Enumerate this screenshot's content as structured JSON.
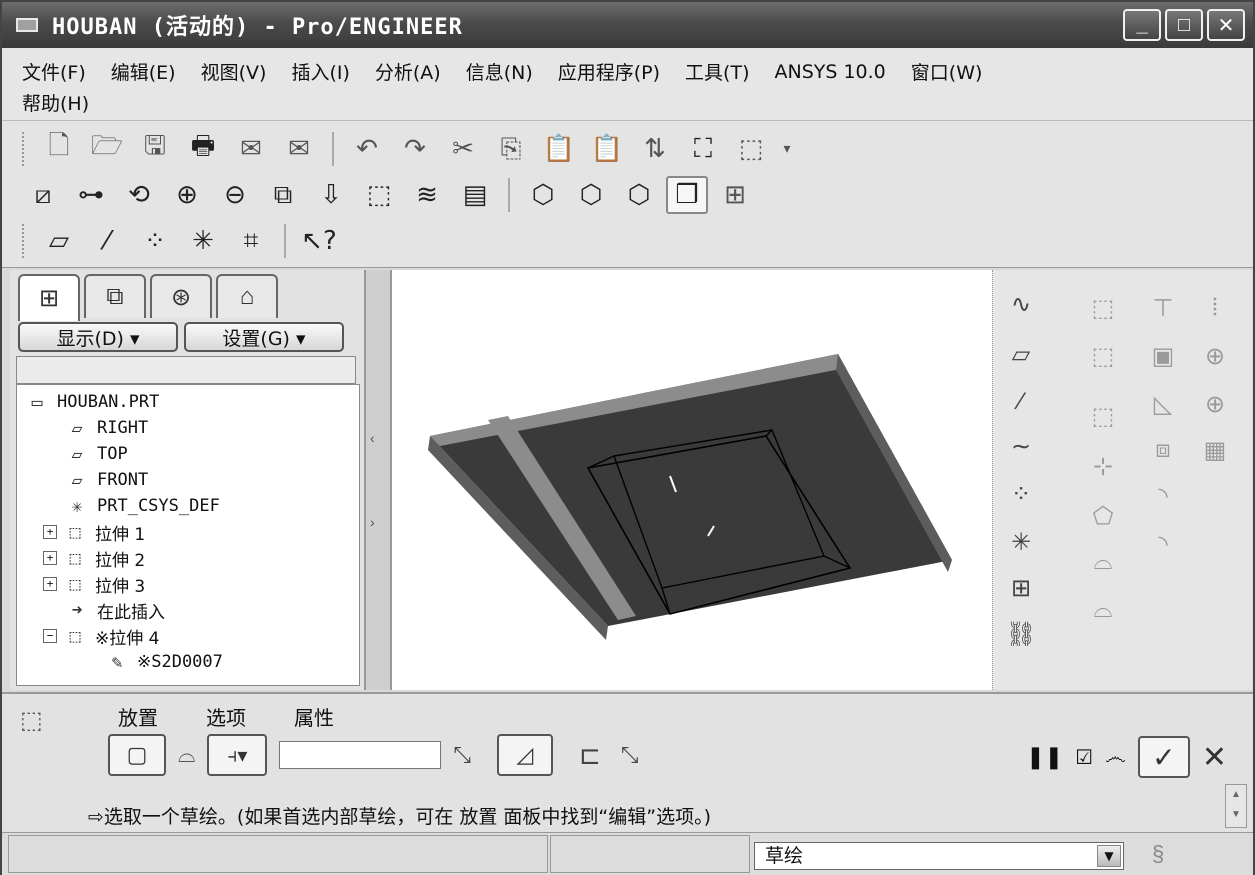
{
  "window": {
    "title": "HOUBAN (活动的) - Pro/ENGINEER",
    "min_glyph": "_",
    "max_glyph": "□",
    "close_glyph": "✕"
  },
  "menu": {
    "row1": [
      "文件(F)",
      "编辑(E)",
      "视图(V)",
      "插入(I)",
      "分析(A)",
      "信息(N)",
      "应用程序(P)",
      "工具(T)",
      "ANSYS 10.0",
      "窗口(W)"
    ],
    "row2": [
      "帮助(H)"
    ]
  },
  "model_tree": {
    "display_btn": "显示(D) ▾",
    "settings_btn": "设置(G) ▾",
    "nodes": [
      {
        "label": "HOUBAN.PRT",
        "icon": "part-icon",
        "glyph": "▭",
        "exp": ""
      },
      {
        "label": "RIGHT",
        "icon": "datum-plane-icon",
        "glyph": "▱",
        "exp": ""
      },
      {
        "label": "TOP",
        "icon": "datum-plane-icon",
        "glyph": "▱",
        "exp": ""
      },
      {
        "label": "FRONT",
        "icon": "datum-plane-icon",
        "glyph": "▱",
        "exp": ""
      },
      {
        "label": "PRT_CSYS_DEF",
        "icon": "csys-icon",
        "glyph": "✳",
        "exp": ""
      },
      {
        "label": "拉伸 1",
        "icon": "extrude-icon",
        "glyph": "⬚",
        "exp": "+"
      },
      {
        "label": "拉伸 2",
        "icon": "extrude-icon",
        "glyph": "⬚",
        "exp": "+"
      },
      {
        "label": "拉伸 3",
        "icon": "extrude-icon",
        "glyph": "⬚",
        "exp": "+"
      },
      {
        "label": "在此插入",
        "icon": "insert-here-arrow-icon",
        "glyph": "➜",
        "exp": ""
      },
      {
        "label": "※拉伸 4",
        "icon": "extrude-icon",
        "glyph": "⬚",
        "exp": "−"
      },
      {
        "label": "※S2D0007",
        "icon": "sketch-icon",
        "glyph": "✎",
        "exp": ""
      }
    ]
  },
  "dashboard": {
    "tabs": [
      "放置",
      "选项",
      "属性"
    ],
    "message": "⇨选取一个草绘。(如果首选内部草绘，可在 放置 面板中找到“编辑”选项。)",
    "depth_value": ""
  },
  "status": {
    "selection_filter": "草绘"
  },
  "colors": {
    "model_top": "#3a3a3a",
    "model_side": "#5d5d5d",
    "model_rim": "#8c8c8c"
  }
}
